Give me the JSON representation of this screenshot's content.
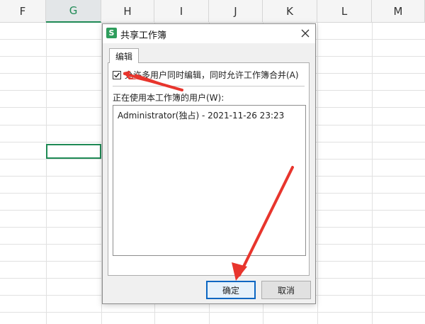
{
  "sheet": {
    "columns": [
      {
        "label": "F",
        "active": false
      },
      {
        "label": "G",
        "active": true
      },
      {
        "label": "H",
        "active": false
      },
      {
        "label": "I",
        "active": false
      },
      {
        "label": "J",
        "active": false
      },
      {
        "label": "K",
        "active": false
      },
      {
        "label": "L",
        "active": false
      },
      {
        "label": "M",
        "active": false
      }
    ]
  },
  "dialog": {
    "title": "共享工作簿",
    "app_icon_letter": "S",
    "tab_label": "编辑",
    "allow_multi_user": {
      "checked": true,
      "label": "允许多用户同时编辑，同时允许工作簿合并(A)"
    },
    "users_label": "正在使用本工作簿的用户(W):",
    "users": [
      "Administrator(独占) - 2021-11-26 23:23"
    ],
    "ok_label": "确定",
    "cancel_label": "取消"
  },
  "colors": {
    "accent_green": "#1f8a55",
    "annotation_red": "#e8352d",
    "focus_blue": "#0a66c2"
  }
}
